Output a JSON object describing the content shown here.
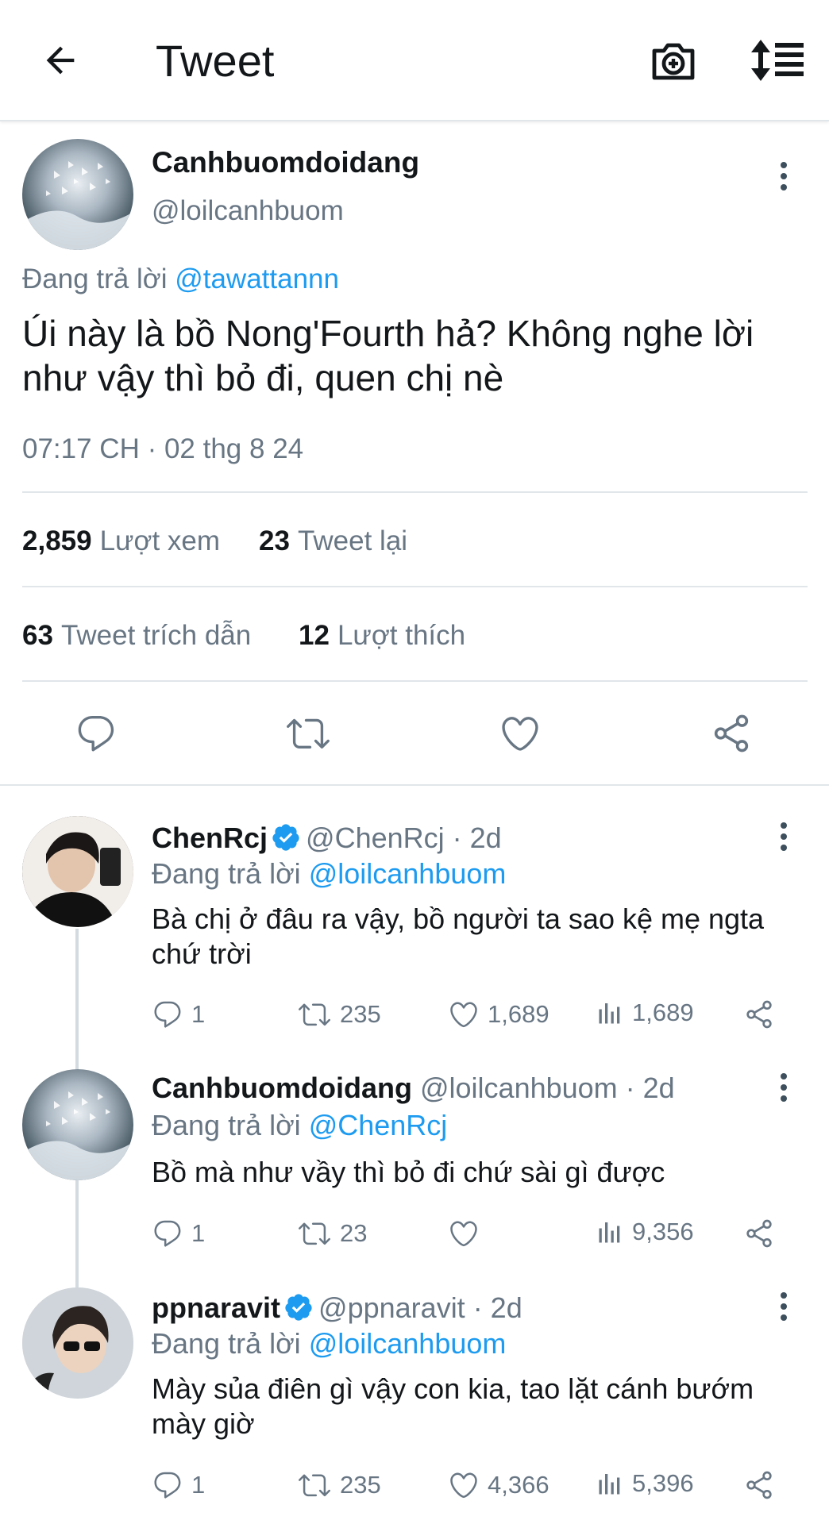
{
  "header": {
    "title": "Tweet",
    "icons": [
      "back-arrow-icon",
      "camera-plus-icon",
      "sort-icon"
    ]
  },
  "main_tweet": {
    "display_name": "Canhbuomdoidang",
    "handle": "@loilcanhbuom",
    "replying_label": "Đang trả lời",
    "replying_to": "@tawattannn",
    "text": "Úi này là bồ Nong'Fourth hả? Không nghe lời như vậy thì bỏ đi, quen chị nè",
    "timestamp": "07:17 CH · 02 thg 8 24",
    "stats": {
      "views_count": "2,859",
      "views_label": "Lượt xem",
      "retweets_count": "23",
      "retweets_label": "Tweet lại",
      "quotes_count": "63",
      "quotes_label": "Tweet trích dẫn",
      "likes_count": "12",
      "likes_label": "Lượt thích"
    }
  },
  "replies": [
    {
      "display_name": "ChenRcj",
      "verified": true,
      "handle_time": "@ChenRcj · 2d",
      "replying_label": "Đang trả lời",
      "replying_to": "@loilcanhbuom",
      "text": "Bà chị ở đâu ra vậy, bồ người ta sao kệ mẹ ngta chứ trời",
      "replies": "1",
      "retweets": "235",
      "likes": "1,689",
      "views": "1,689"
    },
    {
      "display_name": "Canhbuomdoidang",
      "verified": false,
      "handle_time": "@loilcanhbuom · 2d",
      "replying_label": "Đang trả lời",
      "replying_to": "@ChenRcj",
      "text": "Bồ mà như vầy thì bỏ đi chứ sài gì được",
      "replies": "1",
      "retweets": "23",
      "likes": "",
      "views": "9,356"
    },
    {
      "display_name": "ppnaravit",
      "verified": true,
      "handle_time": "@ppnaravit · 2d",
      "replying_label": "Đang trả lời",
      "replying_to": "@loilcanhbuom",
      "text": "Mày sủa điên gì vậy con kia, tao lặt cánh bướm mày giờ",
      "replies": "1",
      "retweets": "235",
      "likes": "4,366",
      "views": "5,396"
    }
  ],
  "colors": {
    "accent": "#1d9bf0",
    "muted": "#687684",
    "divider": "#e1e6ea"
  }
}
